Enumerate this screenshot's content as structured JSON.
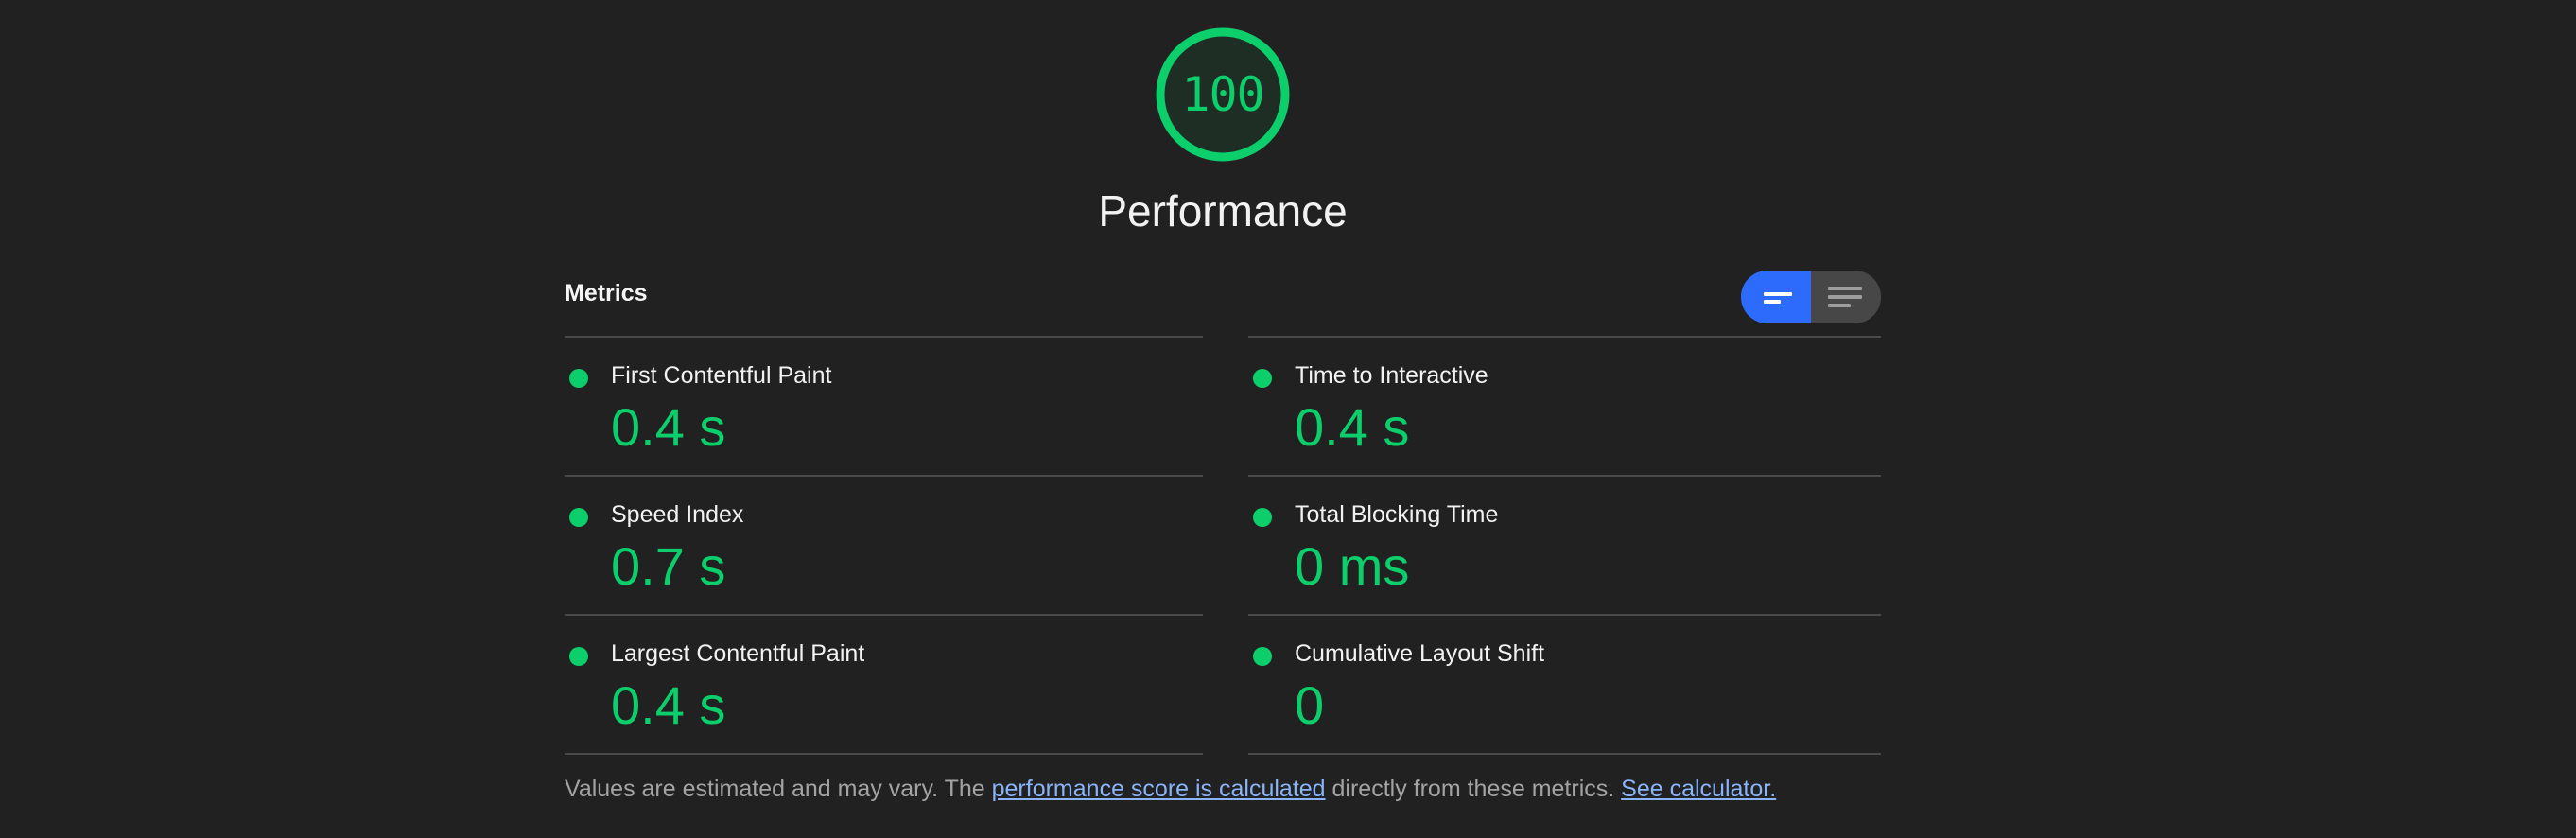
{
  "gauge": {
    "score": "100",
    "label": "Performance",
    "color": "#0cce6b"
  },
  "metrics": {
    "header": "Metrics",
    "view_toggle": {
      "active": "summary-view-icon",
      "inactive": "detailed-view-icon",
      "active_color": "#2c6bfb"
    },
    "left": [
      {
        "title": "First Contentful Paint",
        "value": "0.4 s",
        "status": "pass"
      },
      {
        "title": "Speed Index",
        "value": "0.7 s",
        "status": "pass"
      },
      {
        "title": "Largest Contentful Paint",
        "value": "0.4 s",
        "status": "pass"
      }
    ],
    "right": [
      {
        "title": "Time to Interactive",
        "value": "0.4 s",
        "status": "pass"
      },
      {
        "title": "Total Blocking Time",
        "value": "0 ms",
        "status": "pass"
      },
      {
        "title": "Cumulative Layout Shift",
        "value": "0",
        "status": "pass"
      }
    ]
  },
  "footnote": {
    "text_before": "Values are estimated and may vary. The ",
    "link1": "performance score is calculated",
    "text_middle": " directly from these metrics. ",
    "link2": "See calculator."
  }
}
